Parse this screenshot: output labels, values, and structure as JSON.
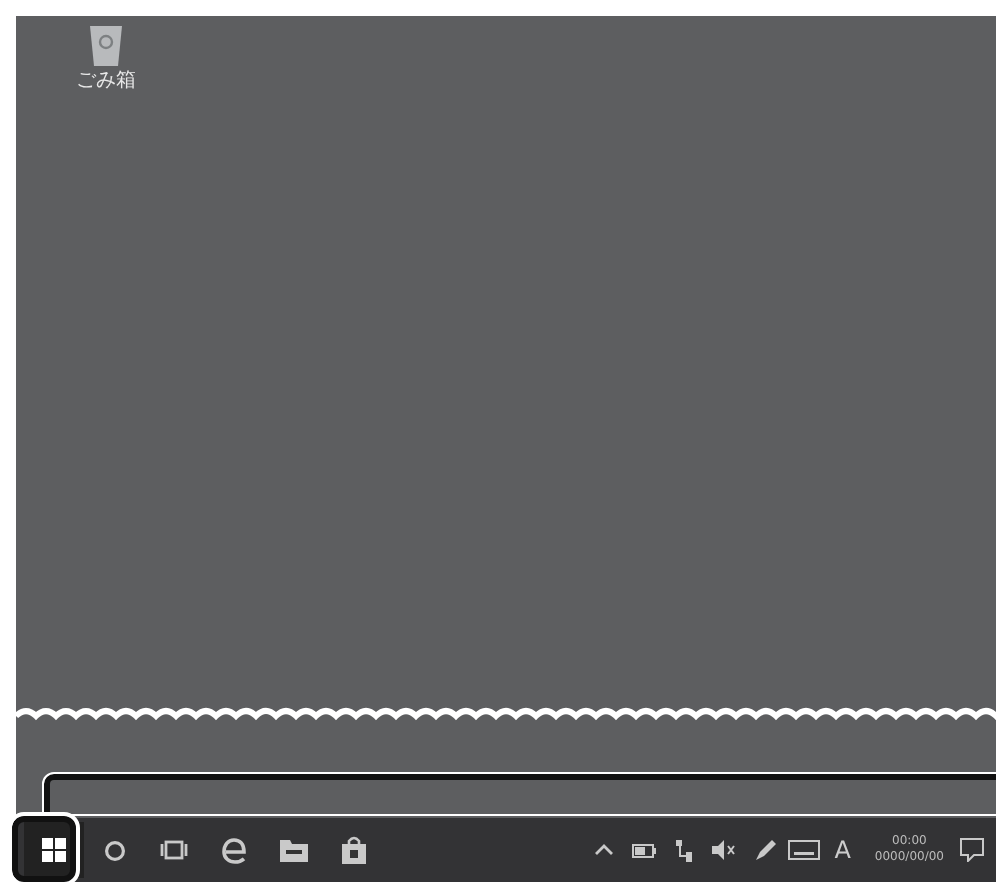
{
  "desktop": {
    "icons": [
      {
        "kind": "recycle-bin",
        "label": "ごみ箱"
      }
    ]
  },
  "taskbar": {
    "pinned": [
      {
        "kind": "start",
        "highlighted": true
      },
      {
        "kind": "search",
        "highlighted": false
      },
      {
        "kind": "taskview",
        "highlighted": false
      },
      {
        "kind": "edge",
        "highlighted": false
      },
      {
        "kind": "folder",
        "highlighted": false
      },
      {
        "kind": "store",
        "highlighted": false
      }
    ],
    "tray": [
      {
        "kind": "chevron"
      },
      {
        "kind": "battery"
      },
      {
        "kind": "network"
      },
      {
        "kind": "volume"
      },
      {
        "kind": "pen"
      },
      {
        "kind": "keyboard"
      }
    ],
    "ime": "A",
    "clock": {
      "time": "00:00",
      "date": "0000/00/00"
    }
  }
}
